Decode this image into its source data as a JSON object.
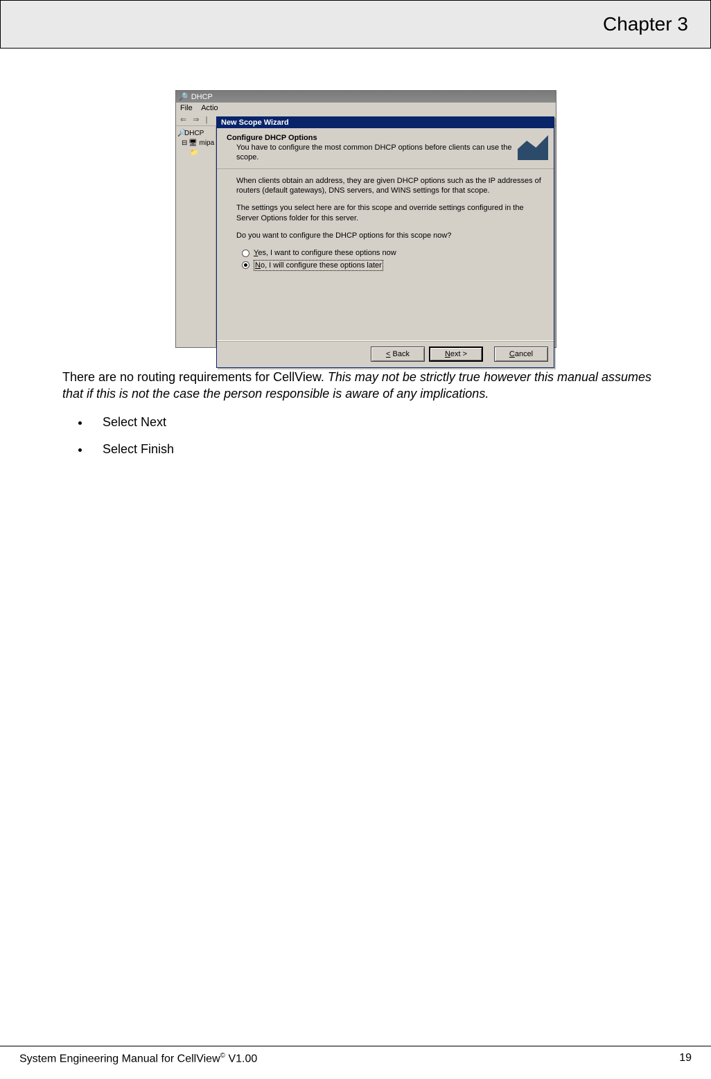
{
  "chapter": "Chapter 3",
  "footer": {
    "left": "System Engineering Manual for CellView",
    "sup": "©",
    "ver": " V1.00",
    "page": "19"
  },
  "mmc": {
    "title": "DHCP",
    "menu": {
      "file": "File",
      "action": "Actio"
    },
    "toolbar": {
      "back": "⇐",
      "fwd": "⇒"
    },
    "tree": {
      "root": "DHCP",
      "server": "mipa"
    }
  },
  "wizard": {
    "title": "New Scope Wizard",
    "head": "Configure DHCP Options",
    "sub": "You have to configure the most common DHCP options before clients can use the scope.",
    "p1": "When clients obtain an address, they are given DHCP options such as the IP addresses of routers (default gateways), DNS servers, and WINS settings for that scope.",
    "p2": "The settings you select here are for this scope and override settings configured in the Server Options folder for this server.",
    "p3": "Do you want to configure the DHCP options for this scope now?",
    "opt_yes": "Yes, I want to configure these options now",
    "opt_no": "No, I will configure these options later",
    "btn_back": "< Back",
    "btn_next": "Next >",
    "btn_cancel": "Cancel"
  },
  "body": {
    "para_plain": "There are no routing requirements for CellView. ",
    "para_italic": "This may not be strictly true however this manual assumes that if this is not the case the person responsible is aware of any implications.",
    "step1": "Select Next",
    "step2": "Select Finish"
  }
}
